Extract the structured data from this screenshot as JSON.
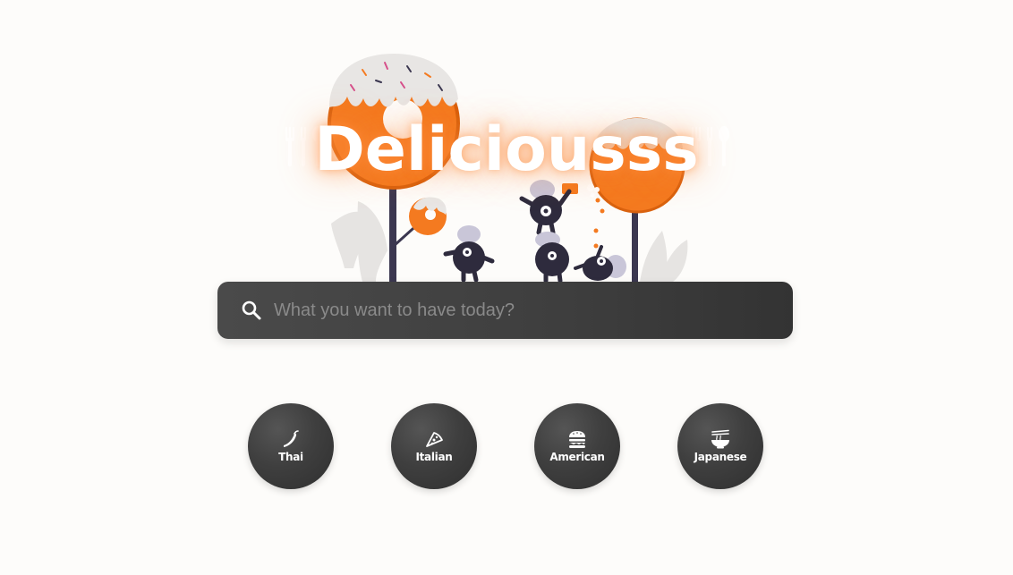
{
  "hero": {
    "title": "Deliciousss",
    "accent_color": "#f47a20"
  },
  "search": {
    "placeholder": "What you want to have today?",
    "value": "",
    "icon": "search-icon"
  },
  "categories": [
    {
      "label": "Thai",
      "icon": "chili-pepper-icon"
    },
    {
      "label": "Italian",
      "icon": "pizza-slice-icon"
    },
    {
      "label": "American",
      "icon": "burger-icon"
    },
    {
      "label": "Japanese",
      "icon": "ramen-bowl-icon"
    }
  ],
  "colors": {
    "background": "#fdfcfa",
    "search_bar": "#3e3e3e",
    "category_button": "#3f3f3f",
    "accent": "#f47a20",
    "character": "#2e2b3d",
    "character_hat": "#c9c6d8"
  }
}
